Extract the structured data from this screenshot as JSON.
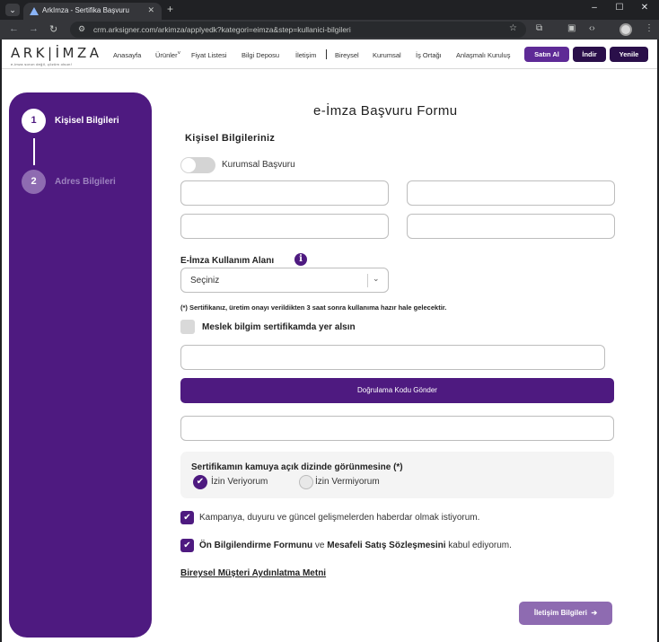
{
  "browser": {
    "tab_title": "ArkImza - Sertifika Başvuru",
    "tab_close": "✕",
    "new_tab": "+",
    "url": "crm.arksigner.com/arkimza/applyedk?kategori=eimza&step=kullanici-bilgileri",
    "controls": {
      "minimize": "–",
      "maximize": "☐",
      "close": "✕"
    }
  },
  "header": {
    "logo": "ARK|İMZA",
    "logo_tagline": "e-imza sorun değil, çözüm olsun!",
    "nav": [
      "Anasayfa",
      "Ürünler",
      "Fiyat Listesi",
      "Bilgi Deposu",
      "İletişim",
      "Bireysel",
      "Kurumsal",
      "İş Ortağı",
      "Anlaşmalı Kuruluş"
    ],
    "buy_button": "Satın Al",
    "download_button": "İndir",
    "renew_button": "Yenile",
    "colors": {
      "buy": "#5e2a96",
      "download": "#2a0f4a",
      "renew": "#2a0f4a"
    }
  },
  "sidebar": {
    "steps": [
      {
        "number": "1",
        "label": "Kişisel Bilgileri"
      },
      {
        "number": "2",
        "label": "Adres Bilgileri"
      }
    ],
    "color": "#4e1a80"
  },
  "form": {
    "title": "e-İmza Başvuru Formu",
    "section_title": "Kişisel Bilgileriniz",
    "corporate_toggle_label": "Kurumsal Başvuru",
    "corporate_toggle_on": false,
    "usage_area_label": "E-İmza Kullanım Alanı",
    "usage_area_value": "Seçiniz",
    "note": "(*) Sertifikanız, üretim onayı verildikten 3 saat sonra kullanıma hazır hale gelecektir.",
    "profession_label": "Meslek bilgim sertifikamda yer alsın",
    "verify_button": "Doğrulama Kodu Gönder",
    "directory_title": "Sertifikamın kamuya açık dizinde görünmesine (*)",
    "allow_label": "İzin Veriyorum",
    "deny_label": "İzin Vermiyorum",
    "campaign_label": "Kampanya, duyuru ve güncel gelişmelerden haberdar olmak istiyorum.",
    "agreement": {
      "part1": "Ön Bilgilendirme Formunu",
      "part2": " ve ",
      "part3": "Mesafeli Satış Sözleşmesini",
      "part4": " kabul ediyorum."
    },
    "privacy_link": "Bireysel Müşteri Aydınlatma Metni",
    "next_button": "İletişim Bilgileri",
    "accent": "#4e1a80"
  }
}
